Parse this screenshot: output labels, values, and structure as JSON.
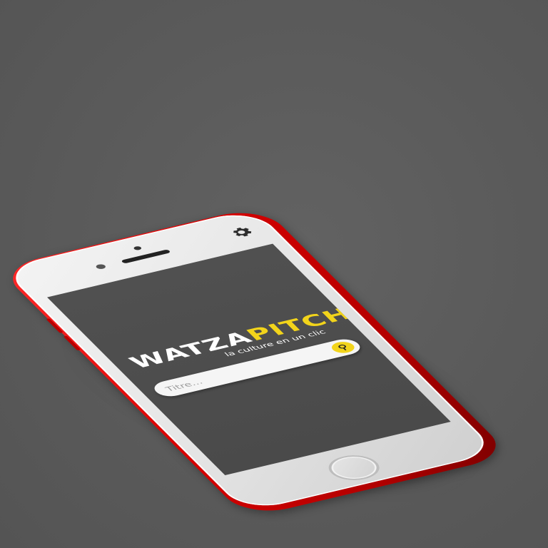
{
  "app": {
    "logo_part1": "WATZA",
    "logo_part2": "PITCH",
    "tagline": "la culture en un clic"
  },
  "search": {
    "placeholder": "Titre...",
    "button_icon": "search-icon"
  },
  "header": {
    "settings_icon": "gear-icon"
  },
  "colors": {
    "accent": "#f2d41b",
    "screen_bg": "#4d4d4d",
    "phone_frame": "#d60000",
    "background": "#5b5b5b"
  }
}
